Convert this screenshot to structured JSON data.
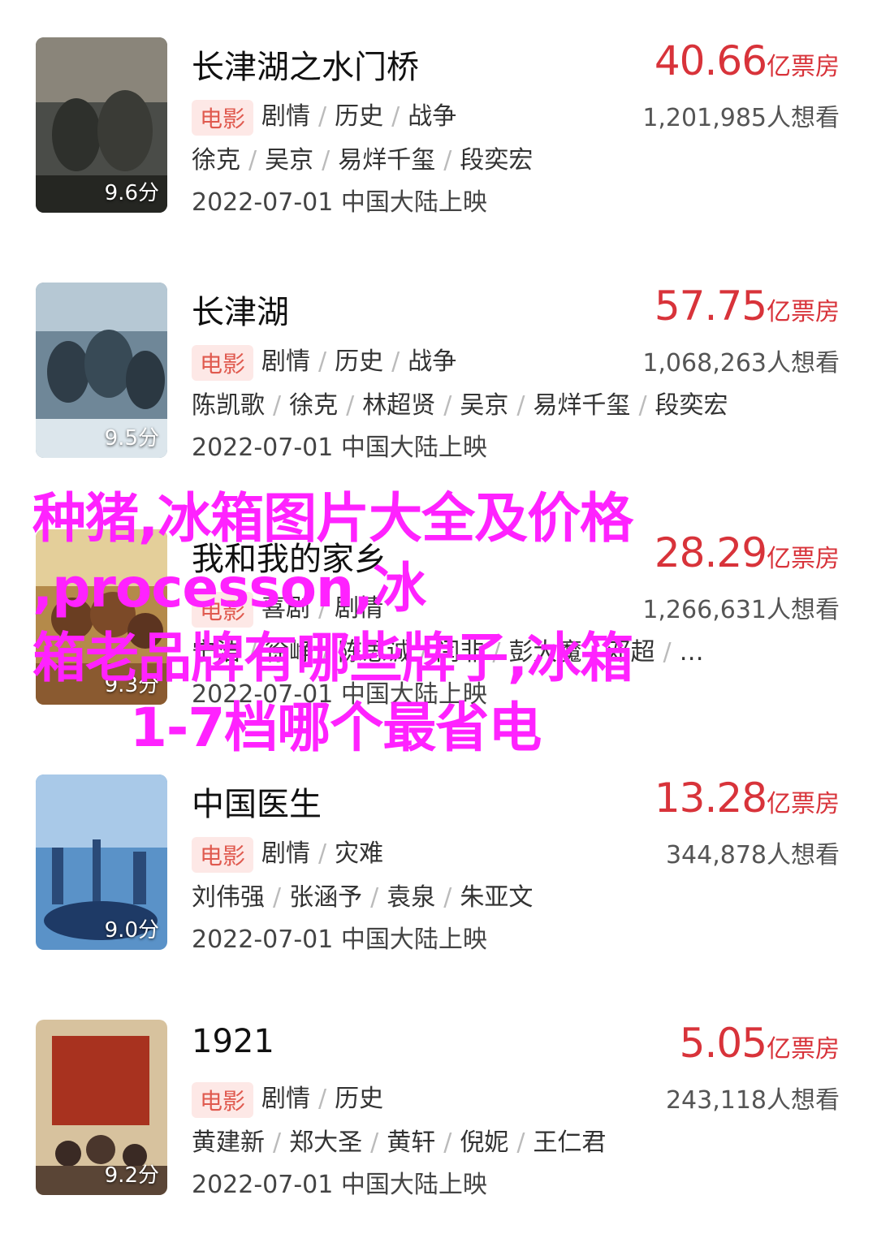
{
  "movies": [
    {
      "title": "长津湖之水门桥",
      "box_num": "40.66",
      "box_unit": "亿票房",
      "want": "1,201,985人想看",
      "tag": "电影",
      "genres": [
        "剧情",
        "历史",
        "战争"
      ],
      "cast": [
        "徐克",
        "吴京",
        "易烊千玺",
        "段奕宏"
      ],
      "release": "2022-07-01 中国大陆上映",
      "score": "9.6分",
      "poster_colors": [
        "#6a6a66",
        "#3a3c3a",
        "#b8a994"
      ]
    },
    {
      "title": "长津湖",
      "box_num": "57.75",
      "box_unit": "亿票房",
      "want": "1,068,263人想看",
      "tag": "电影",
      "genres": [
        "剧情",
        "历史",
        "战争"
      ],
      "cast": [
        "陈凯歌",
        "徐克",
        "林超贤",
        "吴京",
        "易烊千玺",
        "段奕宏"
      ],
      "release": "2022-07-01 中国大陆上映",
      "score": "9.5分",
      "poster_colors": [
        "#5c6f80",
        "#2c3a44",
        "#9fb4c2"
      ]
    },
    {
      "title": "我和我的家乡",
      "box_num": "28.29",
      "box_unit": "亿票房",
      "want": "1,266,631人想看",
      "tag": "电影",
      "genres": [
        "喜剧",
        "剧情"
      ],
      "cast": [
        "宁浩",
        "徐峥",
        "陈思诚",
        "闫非",
        "彭大魔",
        "邓超",
        "…"
      ],
      "release": "2022-07-01 中国大陆上映",
      "score": "9.3分",
      "poster_colors": [
        "#c8a15a",
        "#7a4a2a",
        "#e6d2a0"
      ]
    },
    {
      "title": "中国医生",
      "box_num": "13.28",
      "box_unit": "亿票房",
      "want": "344,878人想看",
      "tag": "电影",
      "genres": [
        "剧情",
        "灾难"
      ],
      "cast": [
        "刘伟强",
        "张涵予",
        "袁泉",
        "朱亚文"
      ],
      "release": "2022-07-01 中国大陆上映",
      "score": "9.0分",
      "poster_colors": [
        "#4f86c0",
        "#1f3d6a",
        "#b9d2ea"
      ]
    },
    {
      "title": "1921",
      "box_num": "5.05",
      "box_unit": "亿票房",
      "want": "243,118人想看",
      "tag": "电影",
      "genres": [
        "剧情",
        "历史"
      ],
      "cast": [
        "黄建新",
        "郑大圣",
        "黄轩",
        "倪妮",
        "王仁君"
      ],
      "release": "2022-07-01 中国大陆上映",
      "score": "9.2分",
      "poster_colors": [
        "#b03a2a",
        "#3a2a24",
        "#d9c2a0"
      ]
    }
  ],
  "overlay": {
    "line1": "种猪,冰箱图片大全及价格",
    "line2": ",processon,冰",
    "line3": "箱老品牌有哪些牌子,冰箱",
    "line4": "1-7档哪个最省电"
  },
  "colors": {
    "accent_red": "#d8333a",
    "tag_bg": "#fde8e6",
    "overlay_magenta": "#ff22ff"
  }
}
